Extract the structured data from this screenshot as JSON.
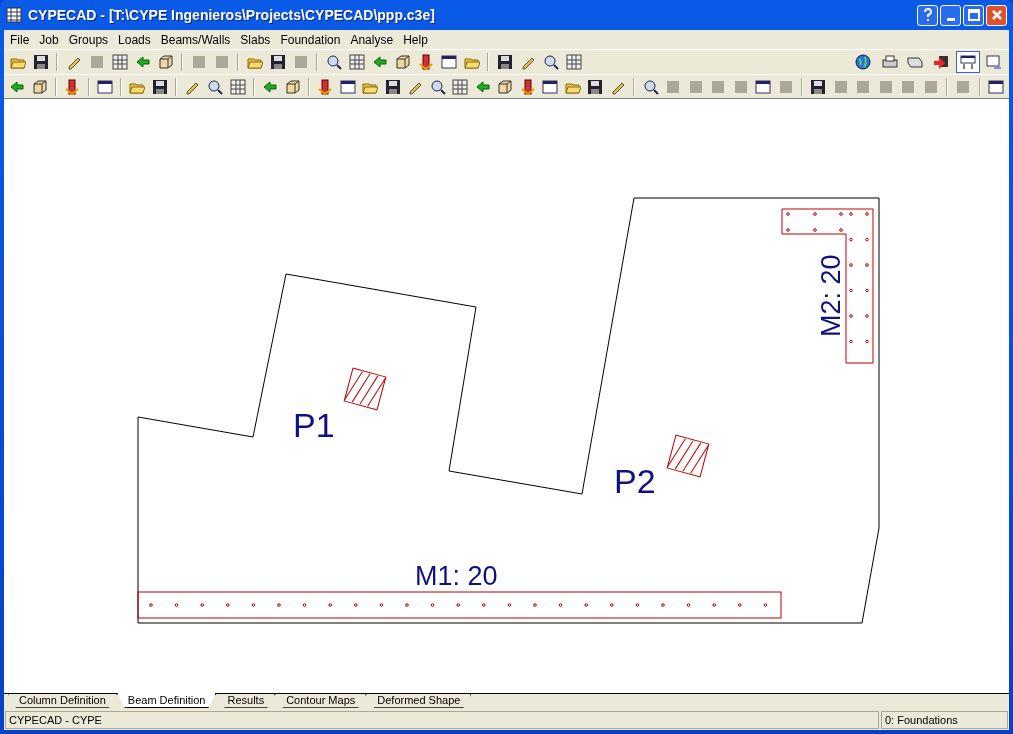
{
  "window": {
    "title": "CYPECAD - [T:\\CYPE Ingenieros\\Projects\\CYPECAD\\ppp.c3e]"
  },
  "menu": [
    "File",
    "Job",
    "Groups",
    "Loads",
    "Beams/Walls",
    "Slabs",
    "Foundation",
    "Analyse",
    "Help"
  ],
  "toolbar_top": [
    [
      {
        "disabled": false
      },
      {
        "disabled": false
      }
    ],
    [
      {
        "disabled": false
      },
      {
        "disabled": true
      },
      {
        "disabled": false
      },
      {
        "disabled": false
      },
      {
        "disabled": false
      }
    ],
    [
      {
        "disabled": true
      },
      {
        "disabled": true
      }
    ],
    [
      {
        "disabled": false
      },
      {
        "disabled": false
      },
      {
        "disabled": true
      }
    ],
    [
      {
        "disabled": false
      },
      {
        "disabled": false
      },
      {
        "disabled": false
      },
      {
        "disabled": false
      },
      {
        "disabled": false
      },
      {
        "disabled": false
      },
      {
        "disabled": false
      }
    ],
    [
      {
        "disabled": false
      },
      {
        "disabled": false
      },
      {
        "disabled": false
      },
      {
        "disabled": false
      }
    ]
  ],
  "toolbar_bottom": [
    [
      {
        "disabled": false
      },
      {
        "disabled": false
      }
    ],
    [
      {
        "disabled": false
      }
    ],
    [
      {
        "disabled": false
      }
    ],
    [
      {
        "disabled": false
      },
      {
        "disabled": false
      }
    ],
    [
      {
        "disabled": false
      },
      {
        "disabled": false
      },
      {
        "disabled": false
      }
    ],
    [
      {
        "disabled": false
      },
      {
        "disabled": false
      }
    ],
    [
      {
        "disabled": false
      },
      {
        "disabled": false
      },
      {
        "disabled": false
      },
      {
        "disabled": false
      },
      {
        "disabled": false
      },
      {
        "disabled": false
      },
      {
        "disabled": false
      },
      {
        "disabled": false
      },
      {
        "disabled": false
      },
      {
        "disabled": false
      },
      {
        "disabled": false
      },
      {
        "disabled": false
      },
      {
        "disabled": false
      },
      {
        "disabled": false
      }
    ],
    [
      {
        "disabled": false
      },
      {
        "disabled": true
      },
      {
        "disabled": true
      },
      {
        "disabled": true
      },
      {
        "disabled": true
      },
      {
        "disabled": false
      },
      {
        "disabled": true
      }
    ],
    [
      {
        "disabled": false
      },
      {
        "disabled": true
      },
      {
        "disabled": true
      },
      {
        "disabled": true
      },
      {
        "disabled": true
      },
      {
        "disabled": true
      }
    ],
    [
      {
        "disabled": true
      }
    ],
    [
      {
        "disabled": false
      }
    ]
  ],
  "drawing": {
    "columns": [
      {
        "label": "P1"
      },
      {
        "label": "P2"
      }
    ],
    "walls": [
      {
        "label": "M1: 20"
      },
      {
        "label": "M2: 20"
      }
    ]
  },
  "tabs": [
    {
      "label": "Column Definition",
      "selected": false
    },
    {
      "label": "Beam Definition",
      "selected": true
    },
    {
      "label": "Results",
      "selected": false
    },
    {
      "label": "Contour Maps",
      "selected": false
    },
    {
      "label": "Deformed Shape",
      "selected": false
    }
  ],
  "status_bar": {
    "left": "CYPECAD - CYPE",
    "right": "0: Foundations"
  }
}
